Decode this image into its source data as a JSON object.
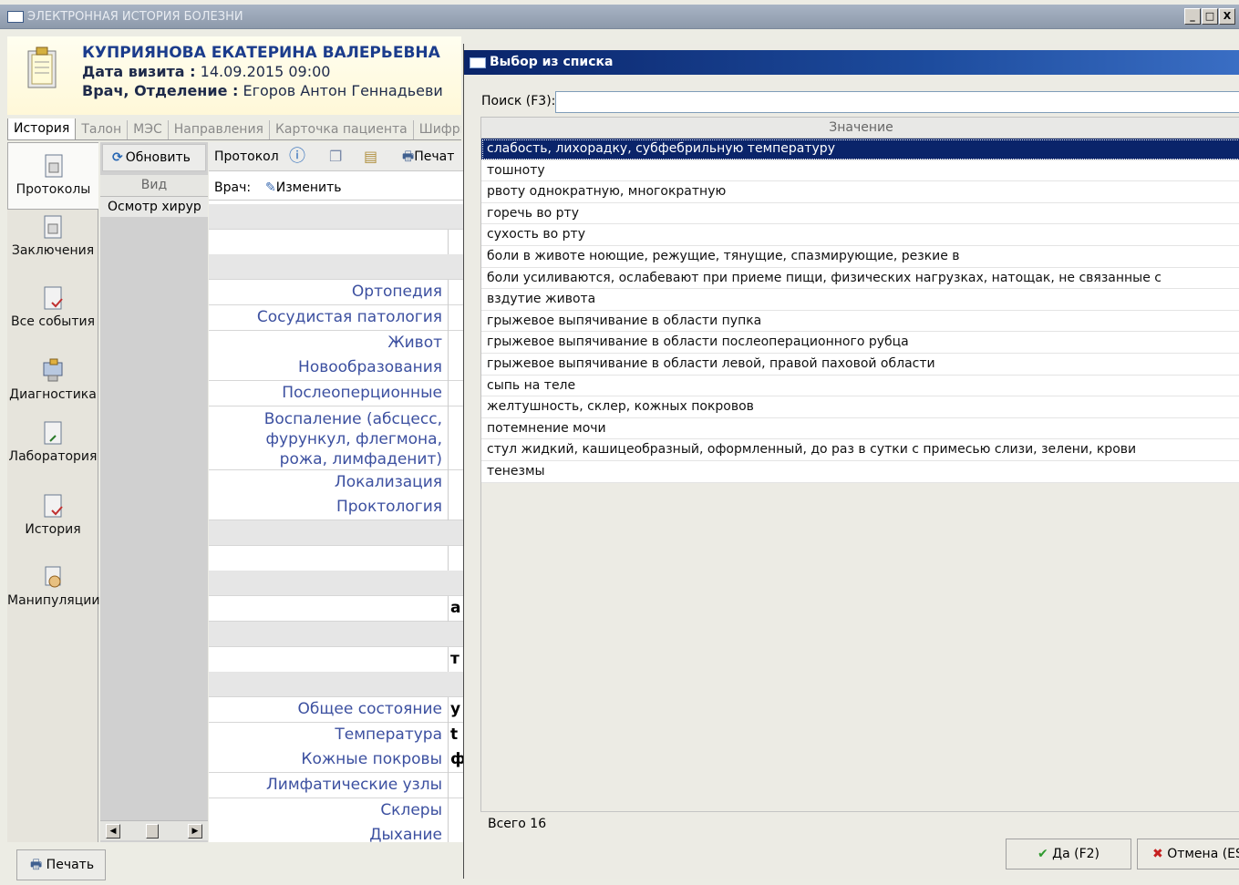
{
  "window": {
    "title": "ЭЛЕКТРОННАЯ ИСТОРИЯ БОЛЕЗНИ",
    "controls": [
      "_",
      "□",
      "X"
    ]
  },
  "patient": {
    "name": "КУПРИЯНОВА ЕКАТЕРИНА ВАЛЕРЬЕВНА",
    "visit_label": "Дата визита :",
    "visit_value": "14.09.2015 09:00",
    "doctor_label": "Врач, Отделение :",
    "doctor_value": "Егоров Антон Геннадьеви"
  },
  "tabs": [
    "История",
    "Талон",
    "МЭС",
    "Направления",
    "Карточка пациента",
    "Шифры"
  ],
  "nav": [
    {
      "label": "Протоколы",
      "icon": "document-icon"
    },
    {
      "label": "Заключения",
      "icon": "document-icon"
    },
    {
      "label": "Все события",
      "icon": "document-check-icon"
    },
    {
      "label": "Диагностика",
      "icon": "computer-icon"
    },
    {
      "label": "Лаборатория",
      "icon": "document-arrow-icon"
    },
    {
      "label": "История",
      "icon": "document-check-icon"
    },
    {
      "label": "Манипуляции",
      "icon": "hand-icon"
    }
  ],
  "list_panel": {
    "refresh_label": "Обновить",
    "column": "Вид",
    "cell": "Осмотр хирур"
  },
  "protocol": {
    "tab_label": "Протокол",
    "print_label": "Печат",
    "doctor_label": "Врач:",
    "edit_label": "Изменить",
    "rows": [
      {
        "label": "",
        "value": "",
        "section": true
      },
      {
        "label": "",
        "value": "",
        "section": false
      },
      {
        "label": "",
        "value": "",
        "section": true
      },
      {
        "label": "Ортопедия",
        "value": "",
        "section": false
      },
      {
        "label": "Сосудистая патология",
        "value": "",
        "section": false
      },
      {
        "label": "Живот",
        "value": "",
        "section": false
      },
      {
        "label": "Новообразования",
        "value": "",
        "section": false
      },
      {
        "label": "Послеоперционные",
        "value": "",
        "section": false
      },
      {
        "label": "Воспаление (абсцесс, фурункул, флегмона, рожа, лимфаденит)",
        "value": "",
        "section": false,
        "tall": true
      },
      {
        "label": "Локализация",
        "value": "",
        "section": false
      },
      {
        "label": "Проктология",
        "value": "",
        "section": false
      },
      {
        "label": "",
        "value": "",
        "section": true
      },
      {
        "label": "",
        "value": "",
        "section": false
      },
      {
        "label": "",
        "value": "",
        "section": true
      },
      {
        "label": "",
        "value": "а",
        "section": false
      },
      {
        "label": "",
        "value": "",
        "section": true
      },
      {
        "label": "",
        "value": "т",
        "section": false
      },
      {
        "label": "",
        "value": "",
        "section": true
      },
      {
        "label": "Общее состояние",
        "value": "у",
        "section": false
      },
      {
        "label": "Температура",
        "value": "t",
        "section": false
      },
      {
        "label": "Кожные покровы",
        "value": "ф",
        "section": false
      },
      {
        "label": "Лимфатические узлы",
        "value": "",
        "section": false
      },
      {
        "label": "Склеры",
        "value": "",
        "section": false
      },
      {
        "label": "Дыхание",
        "value": "",
        "section": false
      }
    ]
  },
  "bottom": {
    "print_label": "Печать"
  },
  "dialog": {
    "title": "Выбор из списка",
    "search_label": "Поиск (F3):",
    "search_value": "",
    "column_header": "Значение",
    "items": [
      "слабость, лихорадку, субфебрильную температуру",
      "тошноту",
      "рвоту однократную, многократную",
      "горечь во рту",
      "сухость во рту",
      "боли в животе ноющие, режущие, тянущие, спазмирующие, резкие в",
      "боли усиливаются, ослабевают при приеме пищи, физических нагрузках, натощак, не связанные с",
      "вздутие живота",
      "грыжевое выпячивание в области пупка",
      "грыжевое выпячивание в области послеоперационного рубца",
      "грыжевое выпячивание в области левой, правой паховой области",
      "сыпь на теле",
      "желтушность, склер, кожных покровов",
      "потемнение мочи",
      "стул жидкий, кашицеобразный, оформленный, до    раз в сутки с примесью слизи, зелени, крови",
      "тенезмы"
    ],
    "selected_index": 0,
    "total_label": "Всего 16",
    "ok_label": "Да (F2)",
    "cancel_label": "Отмена (ES"
  },
  "colors": {
    "selection": "#0a246a",
    "dialog_title_start": "#0a246a",
    "dialog_title_end": "#3a6ec4",
    "patient_name": "#1b3c8c",
    "protocol_label": "#3c50a0"
  }
}
